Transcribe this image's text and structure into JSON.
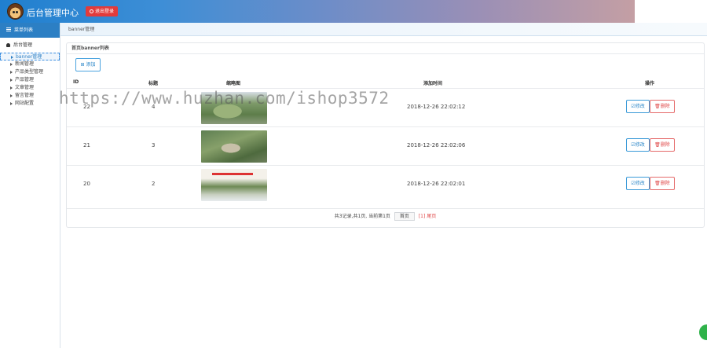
{
  "header": {
    "title": "后台管理中心",
    "logout_label": "退出登录"
  },
  "sidebar": {
    "head": "菜单列表",
    "group": "后台管理",
    "items": [
      "banner管理",
      "新闻管理",
      "产品类型管理",
      "产品管理",
      "文章管理",
      "留言管理",
      "网站配置"
    ]
  },
  "breadcrumb": "banner管理",
  "panel": {
    "title": "首页banner列表",
    "add_label": "添加",
    "columns": [
      "ID",
      "标题",
      "缩略图",
      "添加时间",
      "操作"
    ],
    "rows": [
      {
        "id": "22",
        "title": "4",
        "time": "2018-12-26 22:02:12"
      },
      {
        "id": "21",
        "title": "3",
        "time": "2018-12-26 22:02:06"
      },
      {
        "id": "20",
        "title": "2",
        "time": "2018-12-26 22:02:01"
      }
    ],
    "edit_label": "修改",
    "delete_label": "删除",
    "pager": {
      "summary": "共3记录,共1页, 当前第1页",
      "first": "首页",
      "current": "[1]",
      "last": "尾页"
    }
  },
  "watermark": "https://www.huzhan.com/ishop3572"
}
